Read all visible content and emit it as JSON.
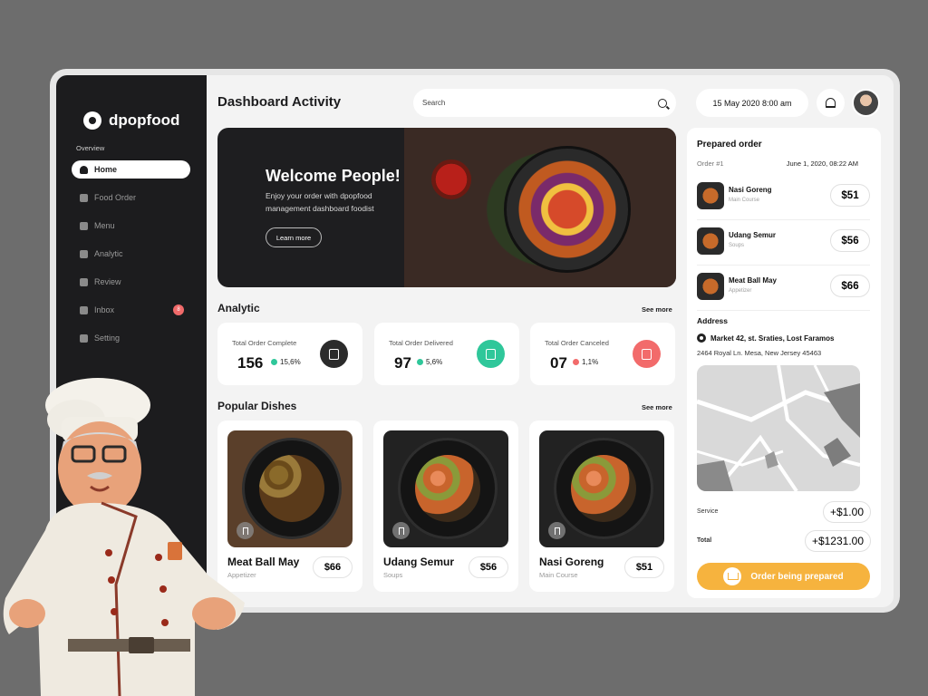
{
  "brand": {
    "name": "dpopfood"
  },
  "sidebar": {
    "section_label": "Overview",
    "items": [
      {
        "label": "Home",
        "icon": "home-icon",
        "active": true
      },
      {
        "label": "Food Order",
        "icon": "document-icon"
      },
      {
        "label": "Menu",
        "icon": "clipboard-icon"
      },
      {
        "label": "Analytic",
        "icon": "bar-chart-icon"
      },
      {
        "label": "Review",
        "icon": "chat-icon"
      },
      {
        "label": "Inbox",
        "icon": "inbox-icon",
        "badge": "8"
      },
      {
        "label": "Setting",
        "icon": "gear-icon"
      }
    ]
  },
  "header": {
    "title": "Dashboard Activity",
    "search_placeholder": "Search",
    "datetime": "15 May 2020 8:00 am"
  },
  "banner": {
    "title": "Welcome People!",
    "subtitle": "Enjoy your order with dpopfood management dashboard foodist",
    "button": "Learn more"
  },
  "analytic": {
    "title": "Analytic",
    "see_more": "See more",
    "cards": [
      {
        "label": "Total Order Complete",
        "value": "156",
        "change": "15,6%",
        "trend": "up",
        "icon": "receipt-icon",
        "icon_color": "#2b2b2b"
      },
      {
        "label": "Total Order Delivered",
        "value": "97",
        "change": "5,6%",
        "trend": "up",
        "icon": "box-check-icon",
        "icon_color": "#2fc79a"
      },
      {
        "label": "Total Order Canceled",
        "value": "07",
        "change": "1,1%",
        "trend": "down",
        "icon": "box-cancel-icon",
        "icon_color": "#f26b6b"
      }
    ]
  },
  "popular": {
    "title": "Popular Dishes",
    "see_more": "See more",
    "dishes": [
      {
        "name": "Meat Ball May",
        "category": "Appetizer",
        "price": "$66"
      },
      {
        "name": "Udang Semur",
        "category": "Soups",
        "price": "$56"
      },
      {
        "name": "Nasi Goreng",
        "category": "Main Course",
        "price": "$51"
      }
    ]
  },
  "order": {
    "title": "Prepared order",
    "number": "Order #1",
    "date": "June 1, 2020, 08:22 AM",
    "items": [
      {
        "name": "Nasi Goreng",
        "category": "Main Course",
        "price": "$51"
      },
      {
        "name": "Udang Semur",
        "category": "Soups",
        "price": "$56"
      },
      {
        "name": "Meat Ball May",
        "category": "Appetizer",
        "price": "$66"
      }
    ],
    "address_title": "Address",
    "address_line1": "Market 42, st. Sraties, Lost Faramos",
    "address_line2": "2464 Royal Ln. Mesa, New Jersey 45463",
    "service_label": "Service",
    "service_value": "+$1.00",
    "total_label": "Total",
    "total_value": "+$1231.00",
    "cta": "Order being prepared"
  },
  "colors": {
    "accent": "#f6b33e",
    "sidebar_bg": "#1c1c1e",
    "success": "#2fc79a",
    "danger": "#f26b6b"
  }
}
